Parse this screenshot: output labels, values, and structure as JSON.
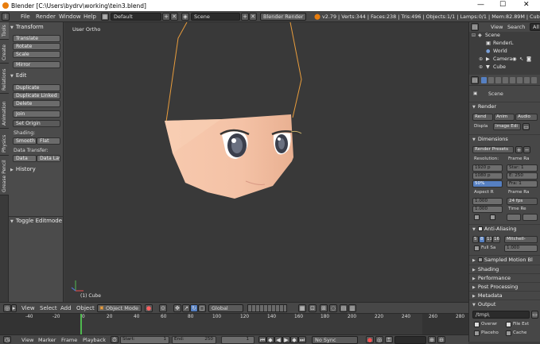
{
  "window": {
    "title": "Blender [C:\\Users\\bydrv\\working\\tein3.blend]",
    "minimize": "—",
    "maximize": "☐",
    "close": "✕"
  },
  "info_header": {
    "menus": [
      "File",
      "Render",
      "Window",
      "Help"
    ],
    "layout": "Default",
    "scene": "Scene",
    "engine": "Blender Render",
    "stats": "v2.79 | Verts:344 | Faces:238 | Tris:496 | Objects:1/1 | Lamps:0/1 | Mem:82.89M | Cube"
  },
  "tool_tabs": [
    "Tools",
    "Create",
    "Relations",
    "Animation",
    "Physics",
    "Grease Pencil"
  ],
  "tool_shelf": {
    "transform_header": "Transform",
    "transform_buttons": [
      "Translate",
      "Rotate",
      "Scale",
      "Mirror"
    ],
    "edit_header": "Edit",
    "edit_buttons": [
      "Duplicate",
      "Duplicate Linked",
      "Delete",
      "Join",
      "Set Origin"
    ],
    "shading_label": "Shading:",
    "shading_buttons": [
      "Smooth",
      "Flat"
    ],
    "data_transfer_label": "Data Transfer:",
    "data_buttons": [
      "Data",
      "Data Lay"
    ],
    "history_header": "History",
    "toggle_editmode": "Toggle Editmode"
  },
  "viewport": {
    "title": "User Ortho",
    "object_label": "(1) Cube"
  },
  "outliner": {
    "view_menu": "View",
    "search_menu": "Search",
    "filter": "All S",
    "rows": [
      "Scene",
      "RenderL",
      "World",
      "Camera",
      "Cube"
    ]
  },
  "properties": {
    "breadcrumb": "Scene",
    "render_header": "Render",
    "render_buttons": [
      "Rend",
      "Anim",
      "Audio"
    ],
    "display_label": "Displa",
    "display_value": "Image Edi",
    "dimensions_header": "Dimensions",
    "render_presets": "Render Presets",
    "resolution_label": "Resolution:",
    "frame_range_label": "Frame Ra",
    "res_x": "1920 p",
    "res_y": "1080 p",
    "res_pct": "50%",
    "start_frame": "Star: 1",
    "end_frame": "E: 250",
    "frame_step": "Fra: 1",
    "aspect_label": "Aspect R",
    "frame_rate_label": "Frame Ra",
    "aspect_x": "1.000",
    "aspect_y": "1.000",
    "fps": "24 fps",
    "time_remap": "Time Re",
    "aa_header": "Anti-Aliasing",
    "aa_samples": [
      "5",
      "8",
      "11",
      "16"
    ],
    "aa_filter": "Mitchell-",
    "full_sample": "Full Sa",
    "aa_size": "1.000",
    "motion_blur": "Sampled Motion Bl",
    "shading": "Shading",
    "performance": "Performance",
    "post_processing": "Post Processing",
    "metadata": "Metadata",
    "output_header": "Output",
    "output_path": "/tmp\\",
    "overwrite": "Overwr",
    "file_ext": "File Ext",
    "placeholders": "Placeho",
    "cache": "Cache"
  },
  "view3d_header": {
    "menus": [
      "View",
      "Select",
      "Add",
      "Object"
    ],
    "mode": "Object Mode",
    "orientation": "Global"
  },
  "timeline": {
    "ticks": [
      "-40",
      "-20",
      "0",
      "20",
      "40",
      "60",
      "80",
      "100",
      "120",
      "140",
      "160",
      "180",
      "200",
      "220",
      "240",
      "260",
      "280"
    ],
    "current_frame": 0
  },
  "timeline_header": {
    "menus": [
      "View",
      "Marker",
      "Frame",
      "Playback"
    ],
    "start": "Start:",
    "start_value": "1",
    "end": "End:",
    "end_value": "250",
    "current": "1",
    "sync": "No Sync"
  },
  "colors": {
    "skin": "#f4c5a9",
    "selection": "#e89c3c",
    "accent": "#5680c2"
  }
}
